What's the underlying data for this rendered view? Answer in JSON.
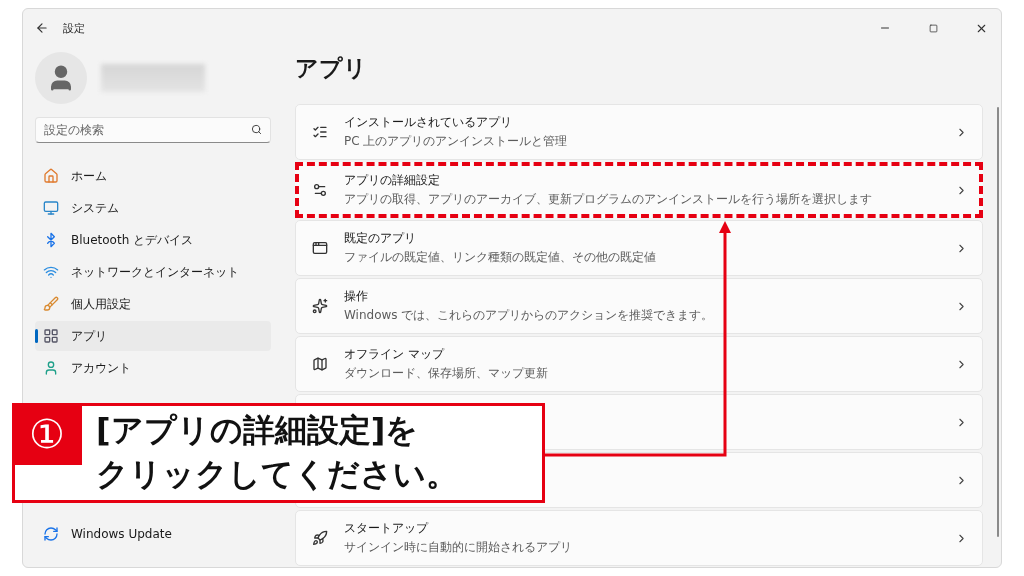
{
  "window": {
    "title": "設定"
  },
  "search": {
    "placeholder": "設定の検索"
  },
  "sidebar": {
    "items": [
      {
        "label": "ホーム",
        "selected": false
      },
      {
        "label": "システム",
        "selected": false
      },
      {
        "label": "Bluetooth とデバイス",
        "selected": false
      },
      {
        "label": "ネットワークとインターネット",
        "selected": false
      },
      {
        "label": "個人用設定",
        "selected": false
      },
      {
        "label": "アプリ",
        "selected": true
      },
      {
        "label": "アカウント",
        "selected": false
      }
    ],
    "bottom_item": {
      "label": "Windows Update"
    }
  },
  "page_title": "アプリ",
  "cards": [
    {
      "kind": "row",
      "title": "インストールされているアプリ",
      "subtitle": "PC 上のアプリのアンインストールと管理",
      "highlighted": false
    },
    {
      "kind": "row",
      "title": "アプリの詳細設定",
      "subtitle": "アプリの取得、アプリのアーカイブ、更新プログラムのアンインストールを行う場所を選択します",
      "highlighted": true
    },
    {
      "kind": "row",
      "title": "既定のアプリ",
      "subtitle": "ファイルの既定値、リンク種類の既定値、その他の既定値",
      "highlighted": false
    },
    {
      "kind": "row",
      "title": "操作",
      "subtitle": "Windows では、これらのアプリからのアクションを推奨できます。",
      "highlighted": false
    },
    {
      "kind": "row",
      "title": "オフライン マップ",
      "subtitle": "ダウンロード、保存場所、マップ更新",
      "highlighted": false
    },
    {
      "kind": "covered",
      "highlighted": false
    },
    {
      "kind": "covered",
      "highlighted": false
    },
    {
      "kind": "row",
      "title": "スタートアップ",
      "subtitle": "サインイン時に自動的に開始されるアプリ",
      "highlighted": false
    }
  ],
  "callout": {
    "number": "①",
    "lines": [
      "[アプリの詳細設定]を",
      "クリックしてください。"
    ]
  }
}
